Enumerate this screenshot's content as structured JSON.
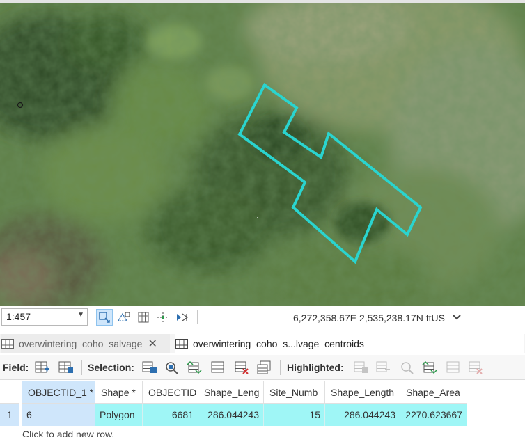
{
  "map": {
    "basemap": "aerial-imagery",
    "polygon_color": "#2ad4cf"
  },
  "statusbar": {
    "scale": "1:457",
    "coordinates": "6,272,358.67E 2,535,238.17N ftUS"
  },
  "tabs": [
    {
      "label": "overwintering_coho_salvage",
      "active": false
    },
    {
      "label": "overwintering_coho_s...lvage_centroids",
      "active": true
    }
  ],
  "toolbar": {
    "field_label": "Field:",
    "selection_label": "Selection:",
    "highlighted_label": "Highlighted:"
  },
  "table": {
    "columns": [
      "OBJECTID_1 *",
      "Shape *",
      "OBJECTID",
      "Shape_Leng",
      "Site_Numb",
      "Shape_Length",
      "Shape_Area"
    ],
    "rows": [
      {
        "row_number": "1",
        "cells": [
          "6",
          "Polygon",
          "6681",
          "286.044243",
          "15",
          "286.044243",
          "2270.623667"
        ]
      }
    ],
    "add_row_text": "Click to add new row."
  },
  "colors": {
    "selected_row": "#9ff6f6",
    "selected_header": "#cfe6fb",
    "polygon": "#2ad4cf"
  }
}
